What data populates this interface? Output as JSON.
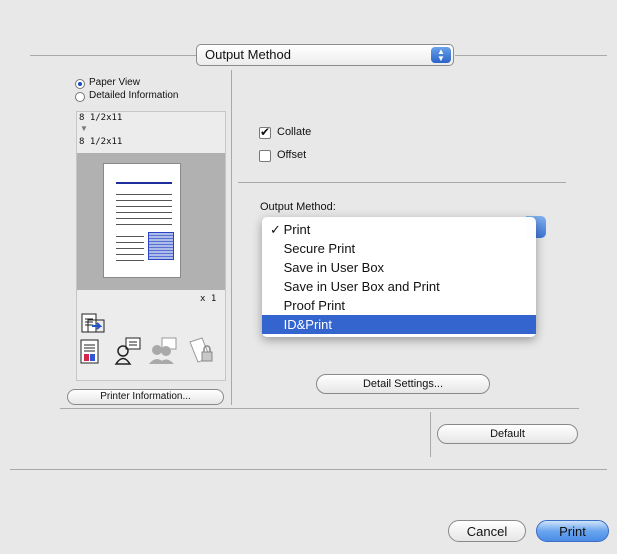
{
  "top_selector": {
    "label": "Output Method"
  },
  "view": {
    "paper_view_label": "Paper View",
    "detailed_info_label": "Detailed Information",
    "selected": "Paper View"
  },
  "preview": {
    "paper_size_top": "8 1/2x11",
    "paper_size_bottom": "8 1/2x11",
    "copies": "x 1"
  },
  "printer_info_button": "Printer Information...",
  "options": {
    "collate_label": "Collate",
    "collate_checked": true,
    "offset_label": "Offset",
    "offset_checked": false
  },
  "output_method": {
    "label": "Output Method:",
    "items": [
      "Print",
      "Secure Print",
      "Save in User Box",
      "Save in User Box and Print",
      "Proof Print",
      "ID&Print"
    ],
    "checked_item": "Print",
    "highlighted_item": "ID&Print"
  },
  "detail_settings_button": "Detail Settings...",
  "default_button": "Default",
  "cancel_button": "Cancel",
  "print_button": "Print",
  "colors": {
    "accent": "#3465cf",
    "primary_button": "#6aa5ee"
  }
}
